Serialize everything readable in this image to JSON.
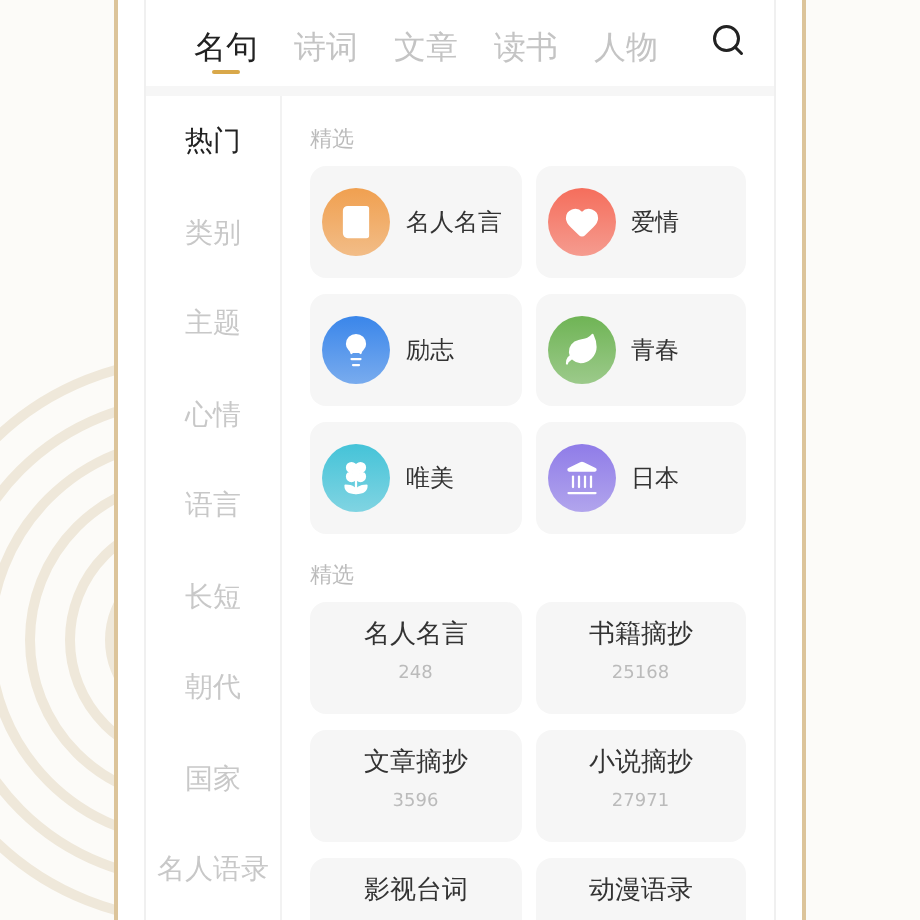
{
  "tabs": [
    {
      "label": "名句",
      "selected": true
    },
    {
      "label": "诗词",
      "selected": false
    },
    {
      "label": "文章",
      "selected": false
    },
    {
      "label": "读书",
      "selected": false
    },
    {
      "label": "人物",
      "selected": false
    }
  ],
  "sidebar": {
    "items": [
      {
        "label": "热门",
        "selected": true
      },
      {
        "label": "类别",
        "selected": false
      },
      {
        "label": "主题",
        "selected": false
      },
      {
        "label": "心情",
        "selected": false
      },
      {
        "label": "语言",
        "selected": false
      },
      {
        "label": "长短",
        "selected": false
      },
      {
        "label": "朝代",
        "selected": false
      },
      {
        "label": "国家",
        "selected": false
      },
      {
        "label": "名人语录",
        "selected": false
      }
    ]
  },
  "sections": [
    {
      "title": "精选",
      "kind": "icon-grid",
      "cards": [
        {
          "label": "名人名言",
          "color": "#f0a050"
        },
        {
          "label": "爱情",
          "color": "#f56e5c"
        },
        {
          "label": "励志",
          "color": "#3a86ea"
        },
        {
          "label": "青春",
          "color": "#6fb455"
        },
        {
          "label": "唯美",
          "color": "#45c3d8"
        },
        {
          "label": "日本",
          "color": "#8f7ce8"
        }
      ]
    },
    {
      "title": "精选",
      "kind": "count-grid",
      "cards": [
        {
          "label": "名人名言",
          "count": "248"
        },
        {
          "label": "书籍摘抄",
          "count": "25168"
        },
        {
          "label": "文章摘抄",
          "count": "3596"
        },
        {
          "label": "小说摘抄",
          "count": "27971"
        },
        {
          "label": "影视台词"
        },
        {
          "label": "动漫语录"
        }
      ]
    }
  ]
}
